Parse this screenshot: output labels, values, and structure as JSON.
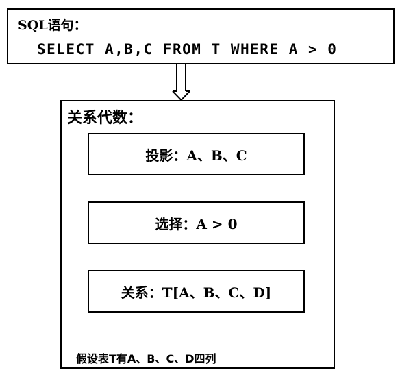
{
  "sql_box": {
    "title": "SQL语句：",
    "statement": "SELECT A,B,C FROM T WHERE A > 0"
  },
  "relational_algebra": {
    "title": "关系代数：",
    "steps": [
      {
        "label": "投影：A、B、C"
      },
      {
        "label": "选择：A > 0"
      },
      {
        "label": "关系：T[A、B、C、D]"
      }
    ],
    "note": "假设表T有A、B、C、D四列"
  }
}
